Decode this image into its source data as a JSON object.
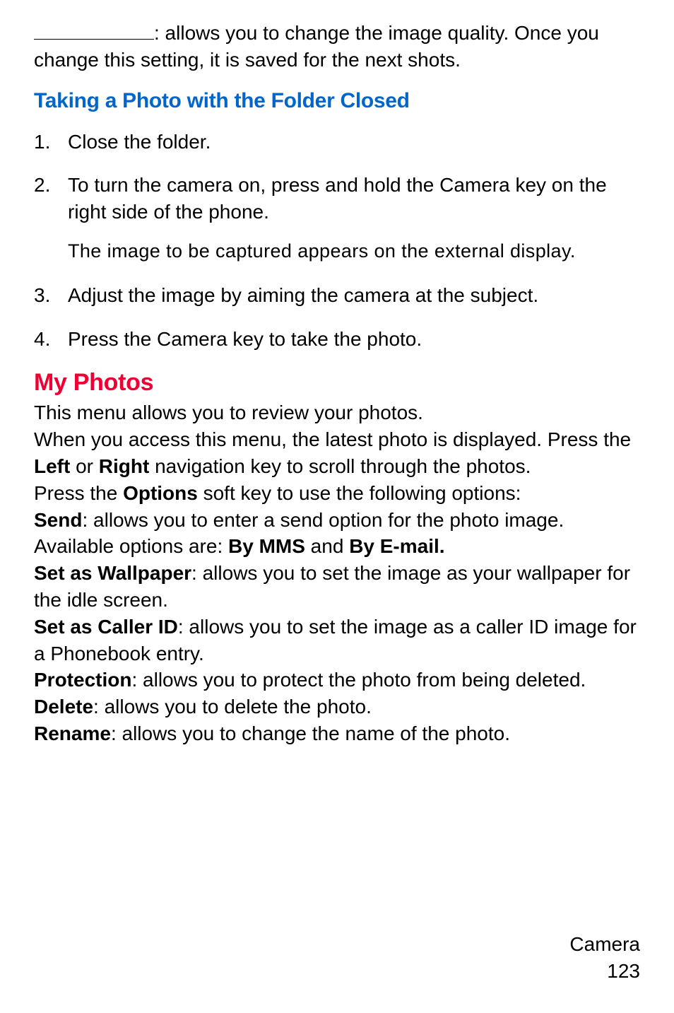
{
  "intro": {
    "text_after_blank": ": allows you to change the image quality. Once you change this setting, it is saved for the next shots."
  },
  "heading_blue": "Taking a Photo with the Folder Closed",
  "steps": [
    {
      "num": "1.",
      "text": "Close the folder."
    },
    {
      "num": "2.",
      "text": "To turn the camera on, press and hold the Camera key on the right side of the phone.",
      "note": "The image to be captured appears on the external display."
    },
    {
      "num": "3.",
      "text": "Adjust the image by aiming the camera at the subject."
    },
    {
      "num": "4.",
      "text": "Press the Camera key to take the photo."
    }
  ],
  "heading_red": "My Photos",
  "myphotos": {
    "p1": "This menu allows you to review your photos.",
    "p2_a": "When you access this menu, the latest photo is displayed. Press the ",
    "p2_left": "Left",
    "p2_or": " or ",
    "p2_right": "Right",
    "p2_b": " navigation key to scroll through the photos.",
    "p3_a": "Press the ",
    "p3_options": "Options",
    "p3_b": " soft key to use the following options:",
    "send_label": "Send",
    "send_text_a": ": allows you to enter a send option for the photo image. Available options are: ",
    "send_mms": "By MMS",
    "send_and": " and ",
    "send_email": "By E-mail.",
    "wallpaper_label": "Set as Wallpaper",
    "wallpaper_text": ": allows you to set the image as your wallpaper for the idle screen.",
    "callerid_label": "Set as Caller ID",
    "callerid_text": ": allows you to set the image as a caller ID image for a Phonebook entry.",
    "protection_label": "Protection",
    "protection_text": ": allows you to protect the photo from being deleted.",
    "delete_label": "Delete",
    "delete_text": ": allows you to delete the photo.",
    "rename_label": "Rename",
    "rename_text": ": allows you to change the name of the photo."
  },
  "footer": {
    "section": "Camera",
    "page": "123"
  }
}
